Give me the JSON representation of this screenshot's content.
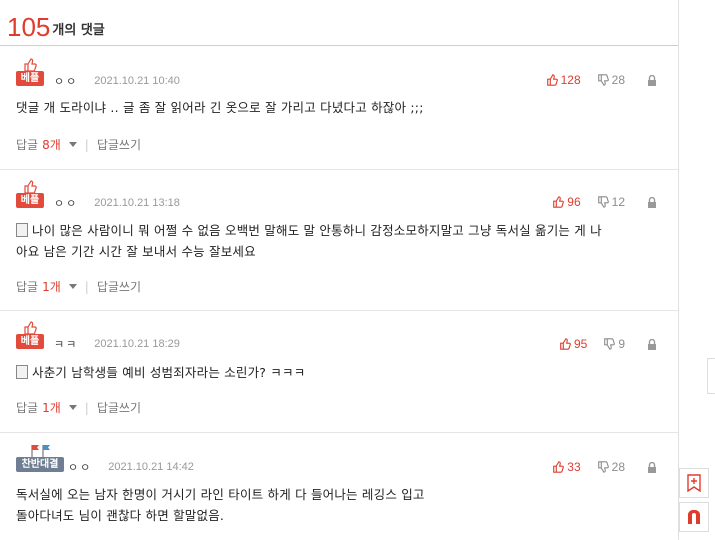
{
  "header": {
    "count": "105",
    "label": "개의 댓글"
  },
  "comments": [
    {
      "badge": "베플",
      "badge_style": "red",
      "name": "ㅇㅇ",
      "date": "2021.10.21 10:40",
      "up": "128",
      "down": "28",
      "text": "댓글 개 도라이냐 .. 글 좀 잘 읽어라 긴 옷으로 잘 가리고 다녔다고 하잖아 ;;;",
      "has_doc_icon": false,
      "reply_label": "답글",
      "reply_count": "8개",
      "write_reply": "답글쓰기"
    },
    {
      "badge": "베플",
      "badge_style": "red",
      "name": "ㅇㅇ",
      "date": "2021.10.21 13:18",
      "up": "96",
      "down": "12",
      "text_line1": "나이 많은 사람이니 뭐 어쩔 수 없음 오백번 말해도 말 안통하니 감정소모하지말고 그냥 독서실 옮기는 게 나",
      "text_line2": "아요 남은 기간 시간 잘 보내서 수능 잘보세요",
      "has_doc_icon": true,
      "reply_label": "답글",
      "reply_count": "1개",
      "write_reply": "답글쓰기"
    },
    {
      "badge": "베플",
      "badge_style": "red",
      "name": "ㅋㅋ",
      "date": "2021.10.21 18:29",
      "up": "95",
      "down": "9",
      "text": "사춘기 남학생들 예비 성범죄자라는 소린가? ㅋㅋㅋ",
      "has_doc_icon": true,
      "reply_label": "답글",
      "reply_count": "1개",
      "write_reply": "답글쓰기"
    },
    {
      "badge": "찬반대결",
      "badge_style": "blue",
      "name": "ㅇㅇ",
      "date": "2021.10.21 14:42",
      "up": "33",
      "down": "28",
      "text_line1": "독서실에 오는 남자 한명이 거시기 라인 타이트 하게 다 들어나는 레깅스 입고",
      "text_line2": "돌아다녀도 님이 괜찮다 하면 할말없음."
    }
  ],
  "colors": {
    "accent": "#e03c2e",
    "badge_blue": "#6f7e92"
  },
  "icons": [
    "thumbs-up-icon",
    "thumbs-down-icon",
    "lock-icon",
    "document-icon",
    "bookmark-add-icon",
    "nate-logo-icon"
  ]
}
